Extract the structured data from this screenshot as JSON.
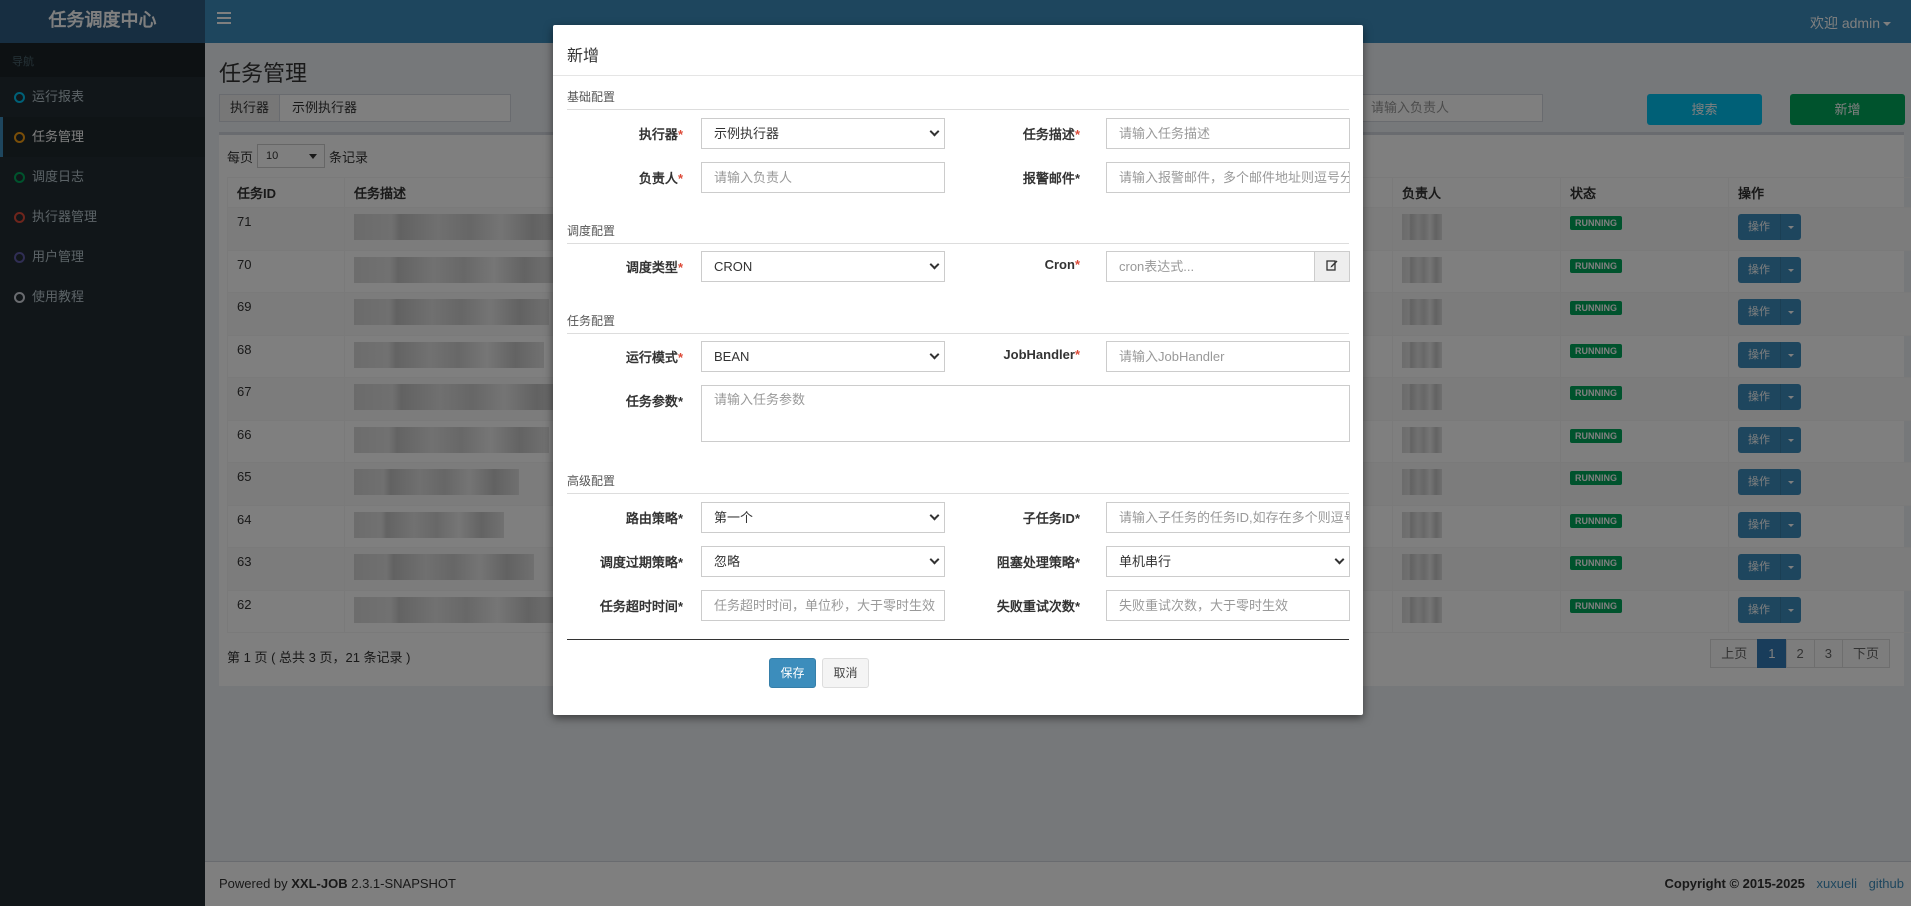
{
  "app": {
    "logo": "任务调度中心",
    "welcome": "欢迎 admin"
  },
  "sidebar": {
    "header": "导航",
    "items": [
      {
        "label": "运行报表",
        "color": "#00c0ef"
      },
      {
        "label": "任务管理",
        "color": "#f39c12"
      },
      {
        "label": "调度日志",
        "color": "#00a65a"
      },
      {
        "label": "执行器管理",
        "color": "#dd4b39"
      },
      {
        "label": "用户管理",
        "color": "#605ca8"
      },
      {
        "label": "使用教程",
        "color": "#d2d6de"
      }
    ]
  },
  "page": {
    "title": "任务管理",
    "executor_label": "执行器",
    "executor_value": "示例执行器",
    "search_person_placeholder": "请输入负责人",
    "search_button": "搜索",
    "add_button": "新增",
    "per_page_prefix": "每页",
    "per_page_value": "10",
    "per_page_suffix": "条记录"
  },
  "table": {
    "headers": {
      "id": "任务ID",
      "desc": "任务描述",
      "owner": "负责人",
      "status": "状态",
      "ops": "操作"
    },
    "rows": [
      {
        "id": "71",
        "status": "RUNNING",
        "op": "操作"
      },
      {
        "id": "70",
        "status": "RUNNING",
        "op": "操作"
      },
      {
        "id": "69",
        "status": "RUNNING",
        "op": "操作"
      },
      {
        "id": "68",
        "status": "RUNNING",
        "op": "操作"
      },
      {
        "id": "67",
        "status": "RUNNING",
        "op": "操作"
      },
      {
        "id": "66",
        "status": "RUNNING",
        "op": "操作"
      },
      {
        "id": "65",
        "status": "RUNNING",
        "op": "操作"
      },
      {
        "id": "64",
        "status": "RUNNING",
        "op": "操作"
      },
      {
        "id": "63",
        "status": "RUNNING",
        "op": "操作"
      },
      {
        "id": "62",
        "status": "RUNNING",
        "op": "操作"
      }
    ]
  },
  "pagination": {
    "info": "第 1 页 ( 总共 3 页，21 条记录 )",
    "prev": "上页",
    "pages": [
      "1",
      "2",
      "3"
    ],
    "current": "1",
    "next": "下页"
  },
  "footer": {
    "powered_prefix": "Powered by ",
    "product": "XXL-JOB",
    "version": " 2.3.1-SNAPSHOT",
    "copyright": "Copyright © 2015-2025",
    "link1": "xuxueli",
    "link2": "github"
  },
  "modal": {
    "title": "新增",
    "sections": {
      "basic": "基础配置",
      "schedule": "调度配置",
      "task": "任务配置",
      "advanced": "高级配置"
    },
    "fields": {
      "executor": {
        "label": "执行器",
        "value": "示例执行器"
      },
      "job_desc": {
        "label": "任务描述",
        "placeholder": "请输入任务描述"
      },
      "author": {
        "label": "负责人",
        "placeholder": "请输入负责人"
      },
      "alarm_email": {
        "label": "报警邮件",
        "placeholder": "请输入报警邮件，多个邮件地址则逗号分隔"
      },
      "schedule_type": {
        "label": "调度类型",
        "value": "CRON"
      },
      "cron": {
        "label": "Cron",
        "placeholder": "cron表达式..."
      },
      "glue_type": {
        "label": "运行模式",
        "value": "BEAN"
      },
      "job_handler": {
        "label": "JobHandler",
        "placeholder": "请输入JobHandler"
      },
      "job_param": {
        "label": "任务参数",
        "placeholder": "请输入任务参数"
      },
      "route_strategy": {
        "label": "路由策略",
        "value": "第一个"
      },
      "child_job": {
        "label": "子任务ID",
        "placeholder": "请输入子任务的任务ID,如存在多个则逗号分隔"
      },
      "misfire": {
        "label": "调度过期策略",
        "value": "忽略"
      },
      "block_strategy": {
        "label": "阻塞处理策略",
        "value": "单机串行"
      },
      "timeout": {
        "label": "任务超时时间",
        "placeholder": "任务超时时间，单位秒，大于零时生效"
      },
      "fail_retry": {
        "label": "失败重试次数",
        "placeholder": "失败重试次数，大于零时生效"
      }
    },
    "save_button": "保存",
    "cancel_button": "取消"
  }
}
